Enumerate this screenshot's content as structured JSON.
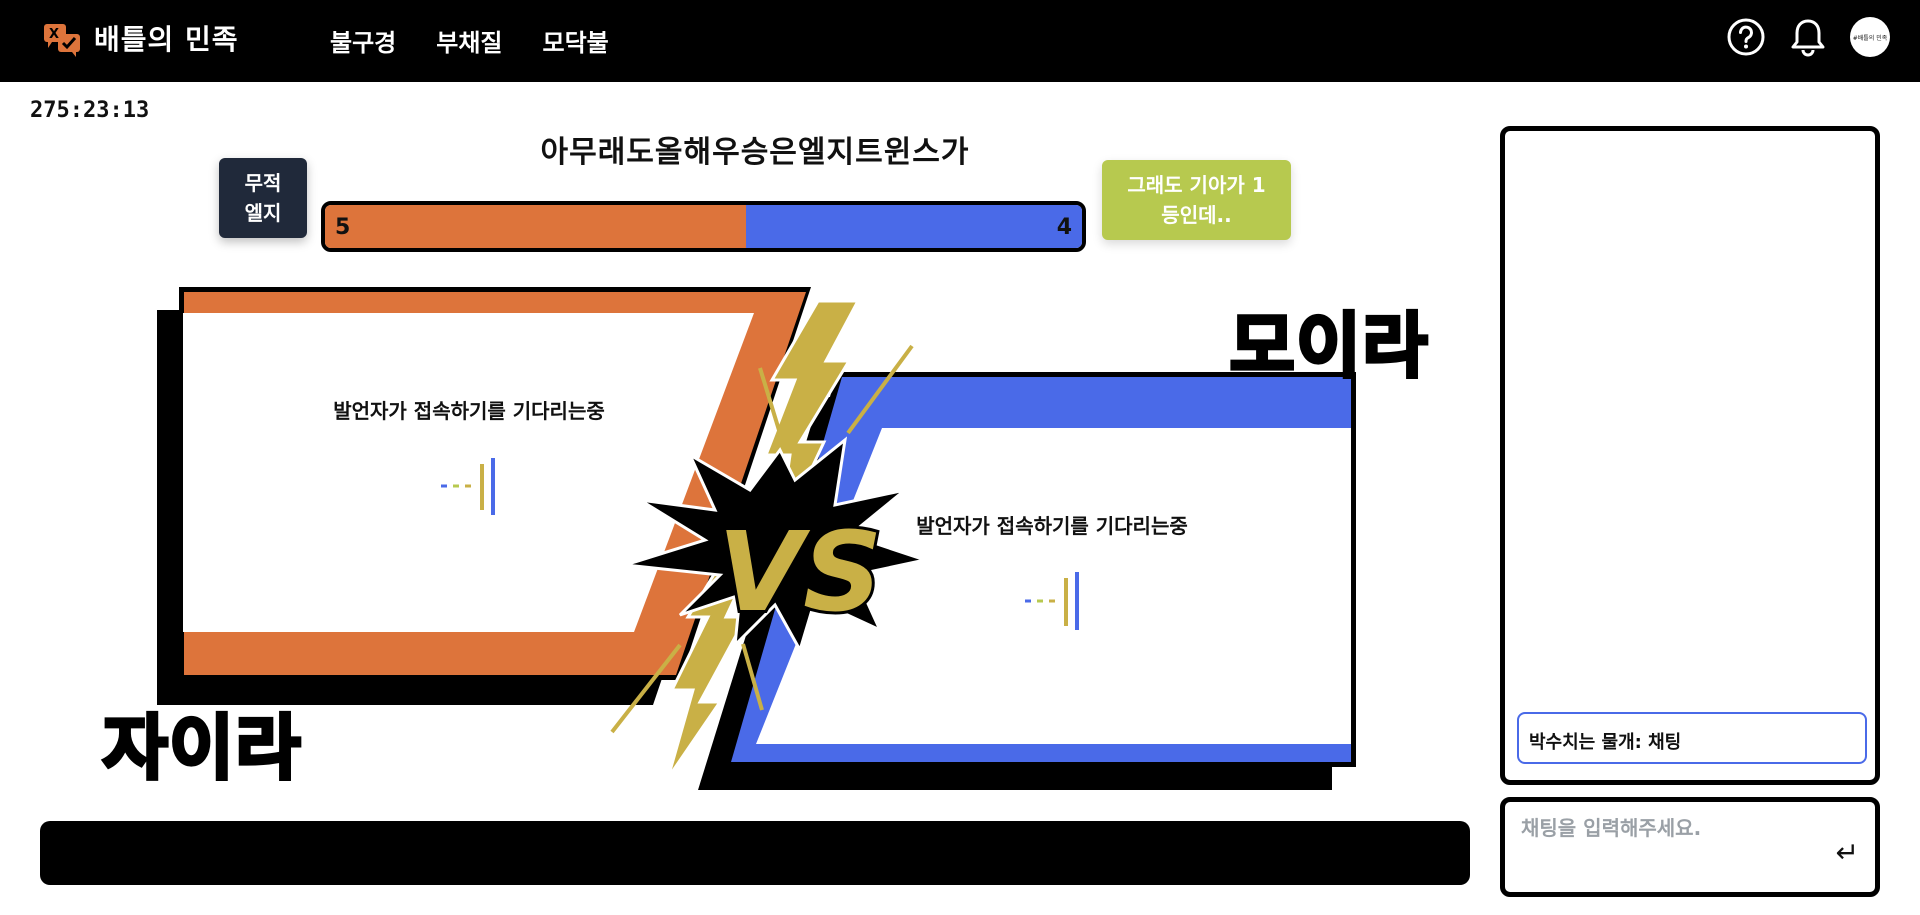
{
  "header": {
    "brand": "배틀의 민족",
    "nav": [
      "불구경",
      "부채질",
      "모닥불"
    ],
    "avatar_text": "#배틀의 민족"
  },
  "timer": "275:23:13",
  "topic": "아무래도올해우승은엘지트윈스가",
  "left_pill": {
    "line1": "무적",
    "line2": "엘지"
  },
  "right_pill": {
    "line1": "그래도 기아가 1",
    "line2": "등인데.."
  },
  "score": {
    "left": "5",
    "right": "4",
    "left_fraction": 0.5556
  },
  "left_panel": {
    "waiting_text": "발언자가 접속하기를 기다리는중",
    "team_name": "자이라"
  },
  "right_panel": {
    "waiting_text": "발언자가 접속하기를 기다리는중",
    "team_name": "모이라"
  },
  "vs_text": "VS",
  "chat": {
    "message": "박수치는 물개: 채팅",
    "input_placeholder": "채팅을 입력해주세요.",
    "enter_icon": "↵"
  },
  "colors": {
    "orange": "#dd743b",
    "blue": "#4a6ae8",
    "gold": "#c9b046",
    "green": "#b7c94f",
    "navy": "#20293a"
  }
}
